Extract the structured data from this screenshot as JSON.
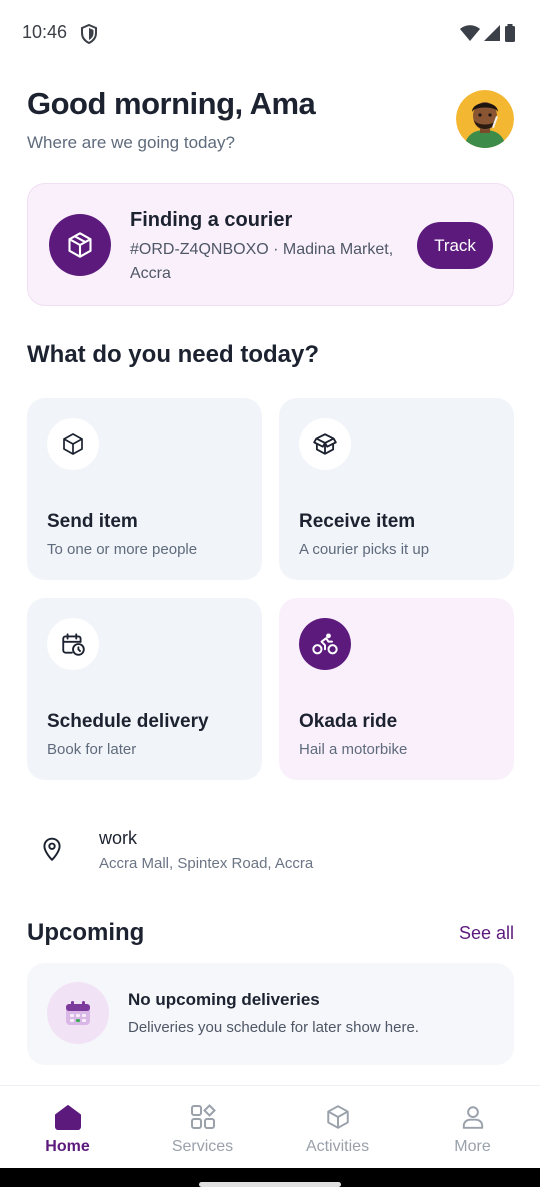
{
  "status_bar": {
    "time": "10:46"
  },
  "header": {
    "greeting": "Good morning, Ama",
    "subtitle": "Where are we going today?"
  },
  "active_order": {
    "title": "Finding a courier",
    "details": "#ORD-Z4QNBOXO · Madina Market, Accra",
    "action_label": "Track"
  },
  "services_section": {
    "title": "What do you need today?",
    "tiles": [
      {
        "title": "Send item",
        "subtitle": "To one or more people",
        "icon": "package-icon"
      },
      {
        "title": "Receive item",
        "subtitle": "A courier picks it up",
        "icon": "open-box-icon"
      },
      {
        "title": "Schedule delivery",
        "subtitle": "Book for later",
        "icon": "calendar-clock-icon"
      },
      {
        "title": "Okada ride",
        "subtitle": "Hail a motorbike",
        "icon": "bike-icon"
      }
    ]
  },
  "saved_place": {
    "name": "work",
    "address": "Accra Mall, Spintex Road, Accra",
    "icon": "map-pin-icon"
  },
  "upcoming": {
    "title": "Upcoming",
    "see_all_label": "See all",
    "empty_title": "No upcoming deliveries",
    "empty_subtitle": "Deliveries you schedule for later show here."
  },
  "bottom_nav": {
    "items": [
      {
        "label": "Home",
        "icon": "home-icon",
        "active": true
      },
      {
        "label": "Services",
        "icon": "grid-icon",
        "active": false
      },
      {
        "label": "Activities",
        "icon": "box-icon",
        "active": false
      },
      {
        "label": "More",
        "icon": "user-icon",
        "active": false
      }
    ]
  },
  "colors": {
    "brand": "#5c1a7d",
    "active_card_bg": "#f9f0fb",
    "tile_bg": "#f1f4f8",
    "text_primary": "#1c2230",
    "text_secondary": "#5f6b7c"
  }
}
